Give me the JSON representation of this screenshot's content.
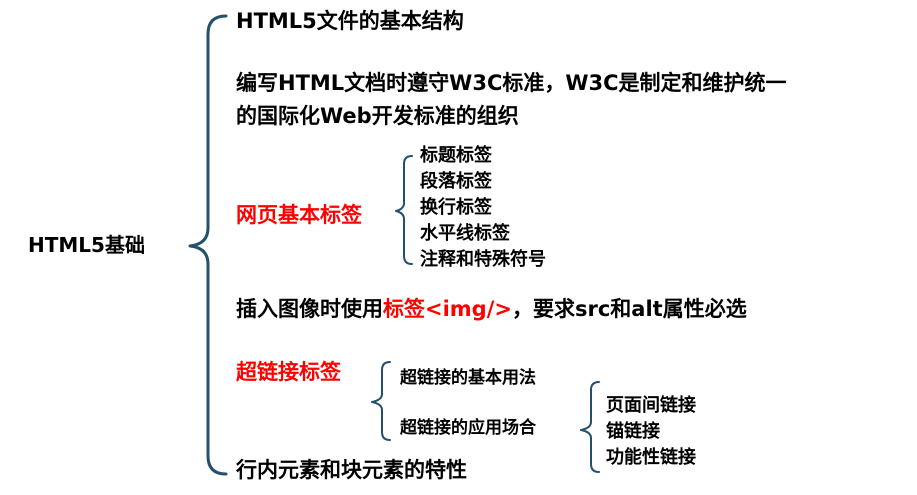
{
  "root": {
    "label": "HTML5基础"
  },
  "items": {
    "structure": "HTML5文件的基本结构",
    "w3c_line1": "编写HTML文档时遵守W3C标准，W3C是制定和维护统一",
    "w3c_line2": "的国际化Web开发标准的组织",
    "basic_tags": {
      "label": "网页基本标签",
      "children": [
        "标题标签",
        "段落标签",
        "换行标签",
        "水平线标签",
        "注释和特殊符号"
      ]
    },
    "img": {
      "prefix": "插入图像时使用",
      "highlight": "标签<img/>",
      "suffix": "，要求src和alt属性必选"
    },
    "hyperlink": {
      "label": "超链接标签",
      "basic_usage": "超链接的基本用法",
      "scenarios": {
        "label": "超链接的应用场合",
        "children": [
          "页面间链接",
          "锚链接",
          "功能性链接"
        ]
      }
    },
    "inline_block": "行内元素和块元素的特性"
  },
  "colors": {
    "brace": "#24506b",
    "text": "#000000",
    "highlight": "#ff0000"
  }
}
